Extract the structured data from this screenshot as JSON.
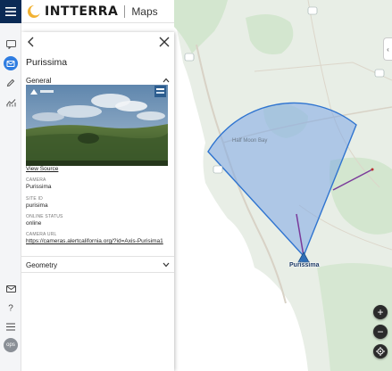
{
  "app": {
    "brand": "INTTERRA",
    "product": "Maps"
  },
  "rail": {
    "items": [
      "chat-icon",
      "layers-icon",
      "pencil-icon",
      "analytics-icon"
    ],
    "bottom": [
      "mail-icon",
      "help-icon",
      "list-icon"
    ],
    "ops_label": "ops"
  },
  "panel": {
    "title": "Purissima",
    "general_label": "General",
    "view_source": "View Source",
    "fields": [
      {
        "label": "CAMERA",
        "value": "Purissima"
      },
      {
        "label": "SITE ID",
        "value": "purisima"
      },
      {
        "label": "ONLINE STATUS",
        "value": "online"
      },
      {
        "label": "CAMERA URL",
        "value": "https://cameras.alertcalifornia.org/?id=Axis-Purisima1"
      }
    ],
    "geometry_label": "Geometry"
  },
  "map": {
    "place_label": "Half Moon Bay",
    "camera_label": "Purissima",
    "zoom_in": "+",
    "zoom_out": "−",
    "collapse": "‹",
    "colors": {
      "ocean": "#ffffff",
      "land": "#e8eee6",
      "fov_fill": "#7da8e6",
      "fov_stroke": "#2f74d0",
      "accent": "#2f7de1"
    }
  }
}
